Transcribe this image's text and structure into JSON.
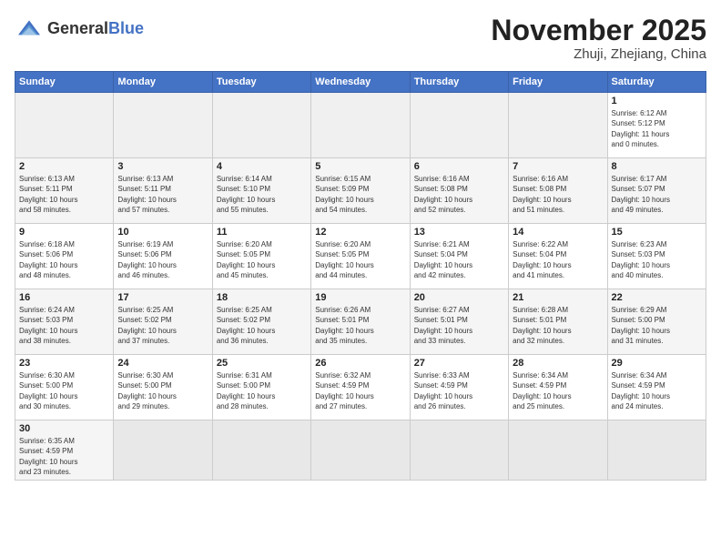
{
  "header": {
    "logo_line1": "General",
    "logo_line2": "Blue",
    "month_title": "November 2025",
    "location": "Zhuji, Zhejiang, China"
  },
  "weekdays": [
    "Sunday",
    "Monday",
    "Tuesday",
    "Wednesday",
    "Thursday",
    "Friday",
    "Saturday"
  ],
  "weeks": [
    [
      {
        "day": "",
        "info": "",
        "empty": true
      },
      {
        "day": "",
        "info": "",
        "empty": true
      },
      {
        "day": "",
        "info": "",
        "empty": true
      },
      {
        "day": "",
        "info": "",
        "empty": true
      },
      {
        "day": "",
        "info": "",
        "empty": true
      },
      {
        "day": "",
        "info": "",
        "empty": true
      },
      {
        "day": "1",
        "info": "Sunrise: 6:12 AM\nSunset: 5:12 PM\nDaylight: 11 hours\nand 0 minutes."
      }
    ],
    [
      {
        "day": "2",
        "info": "Sunrise: 6:13 AM\nSunset: 5:11 PM\nDaylight: 10 hours\nand 58 minutes."
      },
      {
        "day": "3",
        "info": "Sunrise: 6:13 AM\nSunset: 5:11 PM\nDaylight: 10 hours\nand 57 minutes."
      },
      {
        "day": "4",
        "info": "Sunrise: 6:14 AM\nSunset: 5:10 PM\nDaylight: 10 hours\nand 55 minutes."
      },
      {
        "day": "5",
        "info": "Sunrise: 6:15 AM\nSunset: 5:09 PM\nDaylight: 10 hours\nand 54 minutes."
      },
      {
        "day": "6",
        "info": "Sunrise: 6:16 AM\nSunset: 5:08 PM\nDaylight: 10 hours\nand 52 minutes."
      },
      {
        "day": "7",
        "info": "Sunrise: 6:16 AM\nSunset: 5:08 PM\nDaylight: 10 hours\nand 51 minutes."
      },
      {
        "day": "8",
        "info": "Sunrise: 6:17 AM\nSunset: 5:07 PM\nDaylight: 10 hours\nand 49 minutes."
      }
    ],
    [
      {
        "day": "9",
        "info": "Sunrise: 6:18 AM\nSunset: 5:06 PM\nDaylight: 10 hours\nand 48 minutes."
      },
      {
        "day": "10",
        "info": "Sunrise: 6:19 AM\nSunset: 5:06 PM\nDaylight: 10 hours\nand 46 minutes."
      },
      {
        "day": "11",
        "info": "Sunrise: 6:20 AM\nSunset: 5:05 PM\nDaylight: 10 hours\nand 45 minutes."
      },
      {
        "day": "12",
        "info": "Sunrise: 6:20 AM\nSunset: 5:05 PM\nDaylight: 10 hours\nand 44 minutes."
      },
      {
        "day": "13",
        "info": "Sunrise: 6:21 AM\nSunset: 5:04 PM\nDaylight: 10 hours\nand 42 minutes."
      },
      {
        "day": "14",
        "info": "Sunrise: 6:22 AM\nSunset: 5:04 PM\nDaylight: 10 hours\nand 41 minutes."
      },
      {
        "day": "15",
        "info": "Sunrise: 6:23 AM\nSunset: 5:03 PM\nDaylight: 10 hours\nand 40 minutes."
      }
    ],
    [
      {
        "day": "16",
        "info": "Sunrise: 6:24 AM\nSunset: 5:03 PM\nDaylight: 10 hours\nand 38 minutes."
      },
      {
        "day": "17",
        "info": "Sunrise: 6:25 AM\nSunset: 5:02 PM\nDaylight: 10 hours\nand 37 minutes."
      },
      {
        "day": "18",
        "info": "Sunrise: 6:25 AM\nSunset: 5:02 PM\nDaylight: 10 hours\nand 36 minutes."
      },
      {
        "day": "19",
        "info": "Sunrise: 6:26 AM\nSunset: 5:01 PM\nDaylight: 10 hours\nand 35 minutes."
      },
      {
        "day": "20",
        "info": "Sunrise: 6:27 AM\nSunset: 5:01 PM\nDaylight: 10 hours\nand 33 minutes."
      },
      {
        "day": "21",
        "info": "Sunrise: 6:28 AM\nSunset: 5:01 PM\nDaylight: 10 hours\nand 32 minutes."
      },
      {
        "day": "22",
        "info": "Sunrise: 6:29 AM\nSunset: 5:00 PM\nDaylight: 10 hours\nand 31 minutes."
      }
    ],
    [
      {
        "day": "23",
        "info": "Sunrise: 6:30 AM\nSunset: 5:00 PM\nDaylight: 10 hours\nand 30 minutes."
      },
      {
        "day": "24",
        "info": "Sunrise: 6:30 AM\nSunset: 5:00 PM\nDaylight: 10 hours\nand 29 minutes."
      },
      {
        "day": "25",
        "info": "Sunrise: 6:31 AM\nSunset: 5:00 PM\nDaylight: 10 hours\nand 28 minutes."
      },
      {
        "day": "26",
        "info": "Sunrise: 6:32 AM\nSunset: 4:59 PM\nDaylight: 10 hours\nand 27 minutes."
      },
      {
        "day": "27",
        "info": "Sunrise: 6:33 AM\nSunset: 4:59 PM\nDaylight: 10 hours\nand 26 minutes."
      },
      {
        "day": "28",
        "info": "Sunrise: 6:34 AM\nSunset: 4:59 PM\nDaylight: 10 hours\nand 25 minutes."
      },
      {
        "day": "29",
        "info": "Sunrise: 6:34 AM\nSunset: 4:59 PM\nDaylight: 10 hours\nand 24 minutes."
      }
    ],
    [
      {
        "day": "30",
        "info": "Sunrise: 6:35 AM\nSunset: 4:59 PM\nDaylight: 10 hours\nand 23 minutes.",
        "last": true
      },
      {
        "day": "",
        "info": "",
        "empty": true,
        "last": true
      },
      {
        "day": "",
        "info": "",
        "empty": true,
        "last": true
      },
      {
        "day": "",
        "info": "",
        "empty": true,
        "last": true
      },
      {
        "day": "",
        "info": "",
        "empty": true,
        "last": true
      },
      {
        "day": "",
        "info": "",
        "empty": true,
        "last": true
      },
      {
        "day": "",
        "info": "",
        "empty": true,
        "last": true
      }
    ]
  ]
}
